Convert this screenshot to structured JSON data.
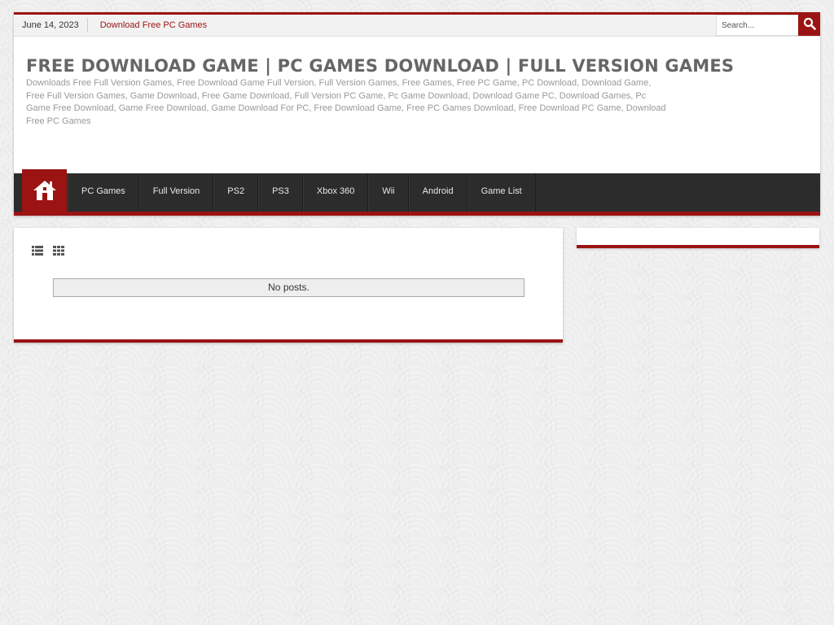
{
  "topbar": {
    "date": "June 14, 2023",
    "link": "Download Free PC Games",
    "search_placeholder": "Search..."
  },
  "header": {
    "title": "FREE DOWNLOAD GAME | PC GAMES DOWNLOAD | FULL VERSION GAMES",
    "description": "Downloads Free Full Version Games, Free Download Game Full Version, Full Version Games, Free Games, Free PC Game, PC Download, Download Game, Free Full Version Games, Game Download, Free Game Download, Full Version PC Game, Pc Game Download, Download Game PC, Download Games, Pc Game Free Download, Game Free Download, Game Download For PC, Free Download Game, Free PC Games Download, Free Download PC Game, Download Free PC Games"
  },
  "nav": {
    "home_icon": "home-icon",
    "items": [
      {
        "label": "PC Games"
      },
      {
        "label": "Full Version"
      },
      {
        "label": "PS2"
      },
      {
        "label": "PS3"
      },
      {
        "label": "Xbox 360"
      },
      {
        "label": "Wii"
      },
      {
        "label": "Android"
      },
      {
        "label": "Game List"
      }
    ]
  },
  "main": {
    "list_view_icon": "list-view-icon",
    "grid_view_icon": "grid-view-icon",
    "no_posts": "No posts."
  },
  "colors": {
    "accent": "#9b1313",
    "nav_bg": "#2c2c2c",
    "title": "#666666",
    "description": "#999999"
  }
}
